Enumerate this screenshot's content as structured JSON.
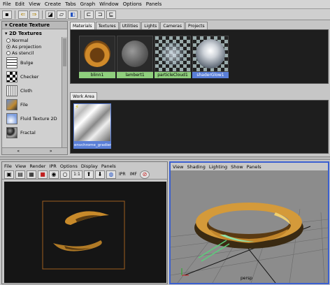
{
  "menubar": [
    "File",
    "Edit",
    "View",
    "Create",
    "Tabs",
    "Graph",
    "Window",
    "Options",
    "Panels"
  ],
  "create_bar": {
    "header": "Create Texture",
    "section": "2D Textures",
    "radio_options": [
      {
        "label": "Normal",
        "selected": false
      },
      {
        "label": "As projection",
        "selected": true
      },
      {
        "label": "As stencil",
        "selected": false
      }
    ],
    "textures": [
      "Bulge",
      "Checker",
      "Cloth",
      "File",
      "Fluid Texture 2D",
      "Fractal"
    ]
  },
  "hypershade_tabs": [
    "Materials",
    "Textures",
    "Utilities",
    "Lights",
    "Cameras",
    "Projects"
  ],
  "swatches": [
    {
      "label": "blinn1",
      "selected": false
    },
    {
      "label": "lambert1",
      "selected": false
    },
    {
      "label": "particleCloud1",
      "selected": false
    },
    {
      "label": "shaderGlow1",
      "selected": true
    }
  ],
  "work_area": {
    "tab": "Work Area",
    "node_label": "envchrome_gradient"
  },
  "render_view": {
    "menu": [
      "File",
      "View",
      "Render",
      "IPR",
      "Options",
      "Display",
      "Panels"
    ],
    "ratio": "1:1",
    "ipr": "IPR",
    "ratio2": "IMF"
  },
  "persp_view": {
    "menu": [
      "View",
      "Shading",
      "Lighting",
      "Show",
      "Panels"
    ],
    "camera_label": "persp"
  },
  "colors": {
    "swatch_label": "#8fcf7d",
    "selected": "#5a7fd8",
    "gold": "#c88a2a"
  }
}
